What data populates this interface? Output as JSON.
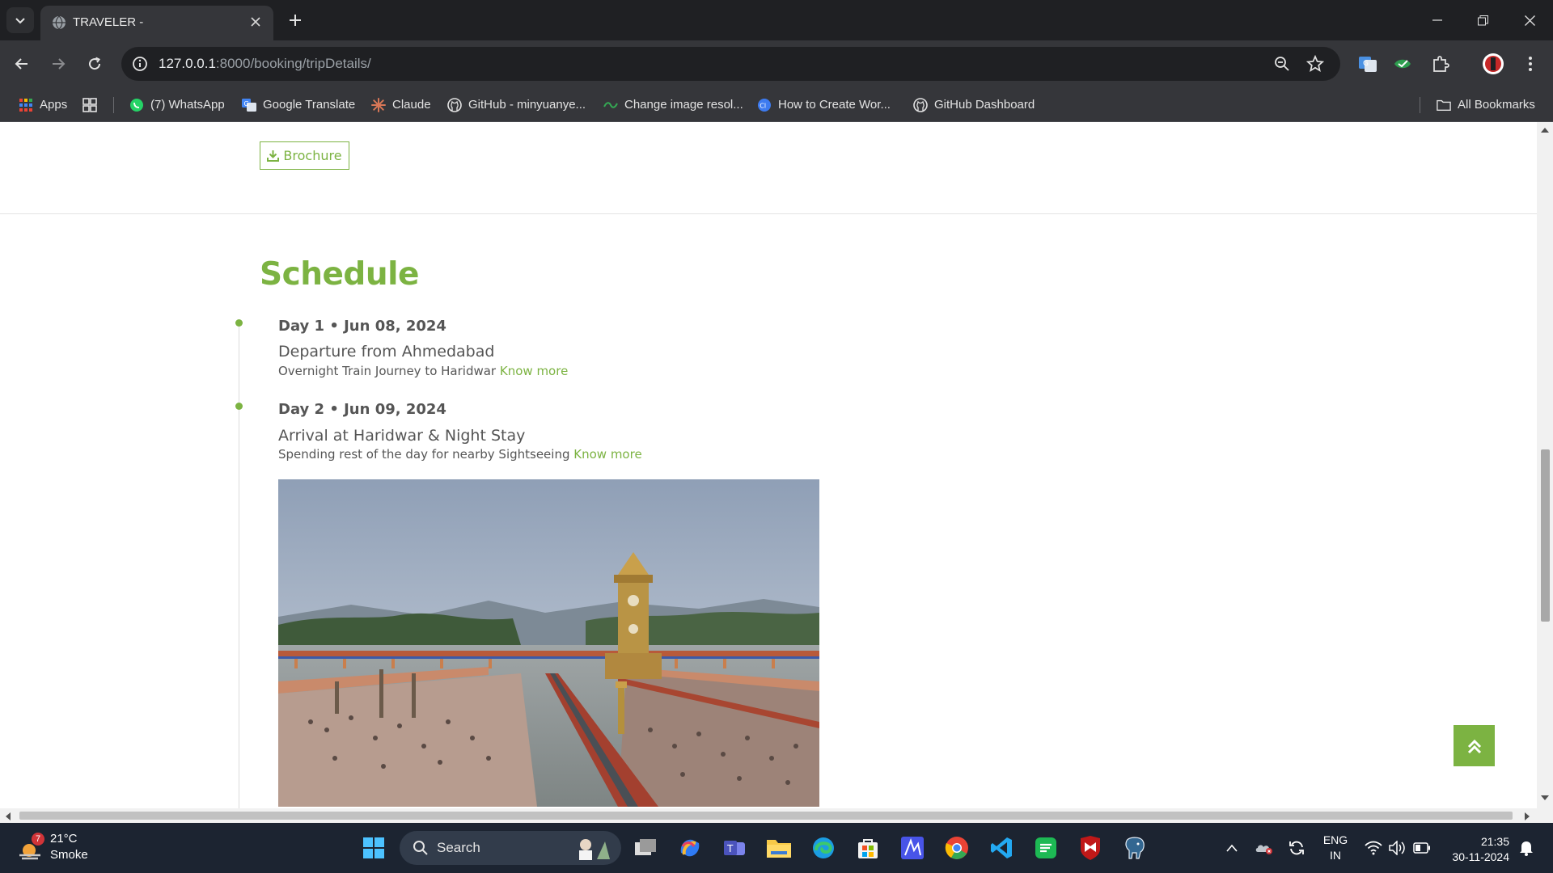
{
  "browser": {
    "tab_title": "TRAVELER -",
    "url_host": "127.0.0.1",
    "url_rest": ":8000/booking/tripDetails/",
    "bookmarks": [
      {
        "label": "Apps"
      },
      {
        "label": "(7) WhatsApp"
      },
      {
        "label": "Google Translate"
      },
      {
        "label": "Claude"
      },
      {
        "label": "GitHub - minyuanye..."
      },
      {
        "label": "Change image resol..."
      },
      {
        "label": "How to Create Wor..."
      },
      {
        "label": "GitHub Dashboard"
      }
    ],
    "all_bookmarks_label": "All Bookmarks"
  },
  "page": {
    "brochure_label": "Brochure",
    "schedule_title": "Schedule",
    "days": [
      {
        "head": "Day 1 • Jun 08, 2024",
        "title": "Departure from Ahmedabad",
        "desc": "Overnight Train Journey to Haridwar",
        "link": "Know more"
      },
      {
        "head": "Day 2 • Jun 09, 2024",
        "title": "Arrival at Haridwar & Night Stay",
        "desc": "Spending rest of the day for nearby Sightseeing",
        "link": "Know more"
      }
    ],
    "accent_color": "#7cb342"
  },
  "taskbar": {
    "weather_badge": "7",
    "temperature": "21°C",
    "condition": "Smoke",
    "search_placeholder": "Search",
    "lang_top": "ENG",
    "lang_bottom": "IN",
    "time": "21:35",
    "date": "30-11-2024"
  }
}
